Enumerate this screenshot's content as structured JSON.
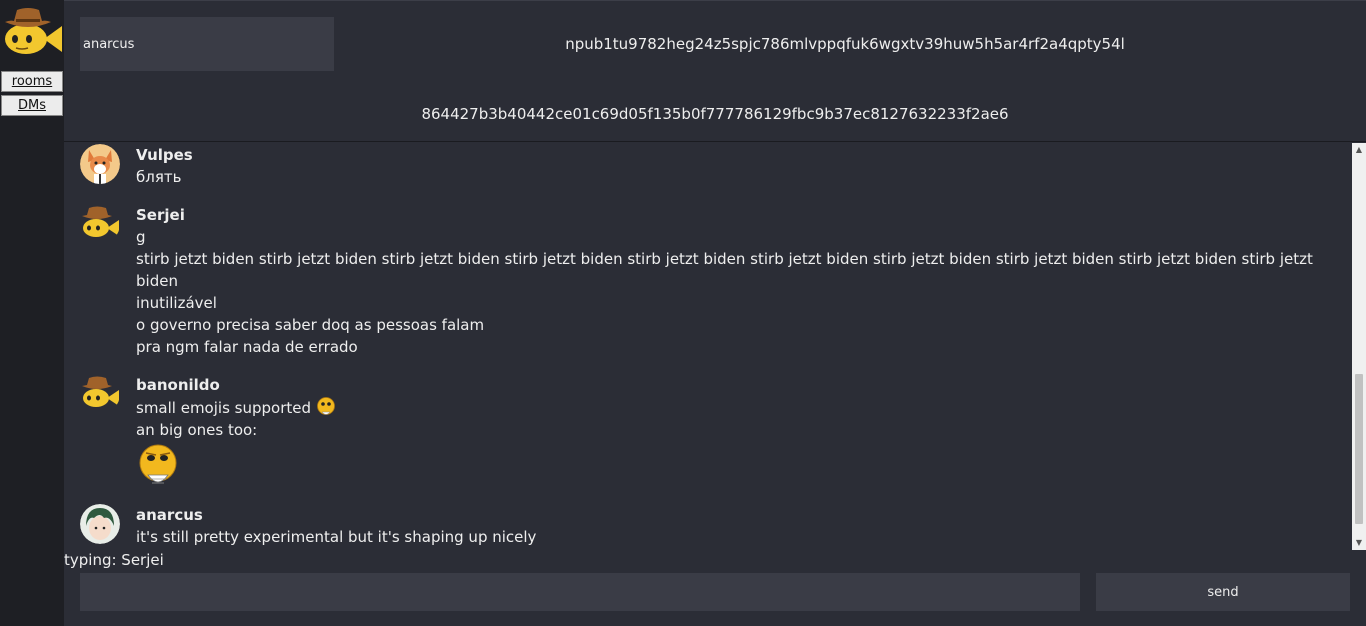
{
  "nav": {
    "rooms_label": "rooms",
    "dms_label": "DMs"
  },
  "header": {
    "name_value": "anarcus",
    "npub": "npub1tu9782heg24z5spjc786mlvppqfuk6wgxtv39huw5h5ar4rf2a4qpty54l",
    "hex": "864427b3b40442ce01c69d05f135b0f777786129fbc9b37ec8127632233f2ae6"
  },
  "messages": [
    {
      "author": "Vulpes",
      "lines": [
        "блять"
      ]
    },
    {
      "author": "Serjei",
      "lines": [
        "g",
        "stirb jetzt biden stirb jetzt biden stirb jetzt biden stirb jetzt biden stirb jetzt biden stirb jetzt biden stirb jetzt biden stirb jetzt biden stirb jetzt biden stirb jetzt biden",
        "inutilizável",
        "o governo precisa saber doq as pessoas falam",
        "pra ngm falar nada de errado"
      ]
    },
    {
      "author": "banonildo",
      "lines": [
        "small emojis supported",
        "an big ones too:"
      ]
    },
    {
      "author": "anarcus",
      "lines": [
        "it's still pretty experimental but it's shaping up nicely"
      ]
    }
  ],
  "typing": "typing: Serjei",
  "composer": {
    "placeholder": "",
    "send_label": "send"
  },
  "colors": {
    "background": "#2b2d36",
    "sidebar": "#1e1f24",
    "input": "#3a3c46"
  }
}
